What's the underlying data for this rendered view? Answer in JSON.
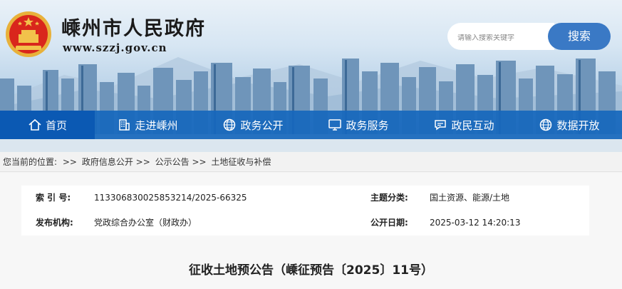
{
  "header": {
    "site_title": "嵊州市人民政府",
    "site_url": "www.szzj.gov.cn",
    "search_placeholder": "请输入搜索关键字",
    "search_button": "搜索"
  },
  "nav": [
    {
      "label": "首页",
      "icon": "home-icon"
    },
    {
      "label": "走进嵊州",
      "icon": "building-icon"
    },
    {
      "label": "政务公开",
      "icon": "globe-icon"
    },
    {
      "label": "政务服务",
      "icon": "monitor-icon"
    },
    {
      "label": "政民互动",
      "icon": "chat-icon"
    },
    {
      "label": "数据开放",
      "icon": "globe-icon"
    }
  ],
  "breadcrumb": {
    "prefix": "您当前的位置:",
    "sep": ">>",
    "items": [
      "政府信息公开",
      "公示公告",
      "土地征收与补偿"
    ]
  },
  "meta": {
    "index_label": "索 引 号:",
    "index_value": "113306830025853214/2025-66325",
    "topic_label": "主题分类:",
    "topic_value": "国土资源、能源/土地",
    "org_label": "发布机构:",
    "org_value": "党政综合办公室（财政办）",
    "date_label": "公开日期:",
    "date_value": "2025-03-12 14:20:13"
  },
  "document": {
    "title": "征收土地预公告（嵊征预告〔2025〕11号）"
  },
  "colors": {
    "nav_bg": "#1767bc",
    "nav_active": "#0b59b3",
    "search_button": "#3a79c5"
  }
}
